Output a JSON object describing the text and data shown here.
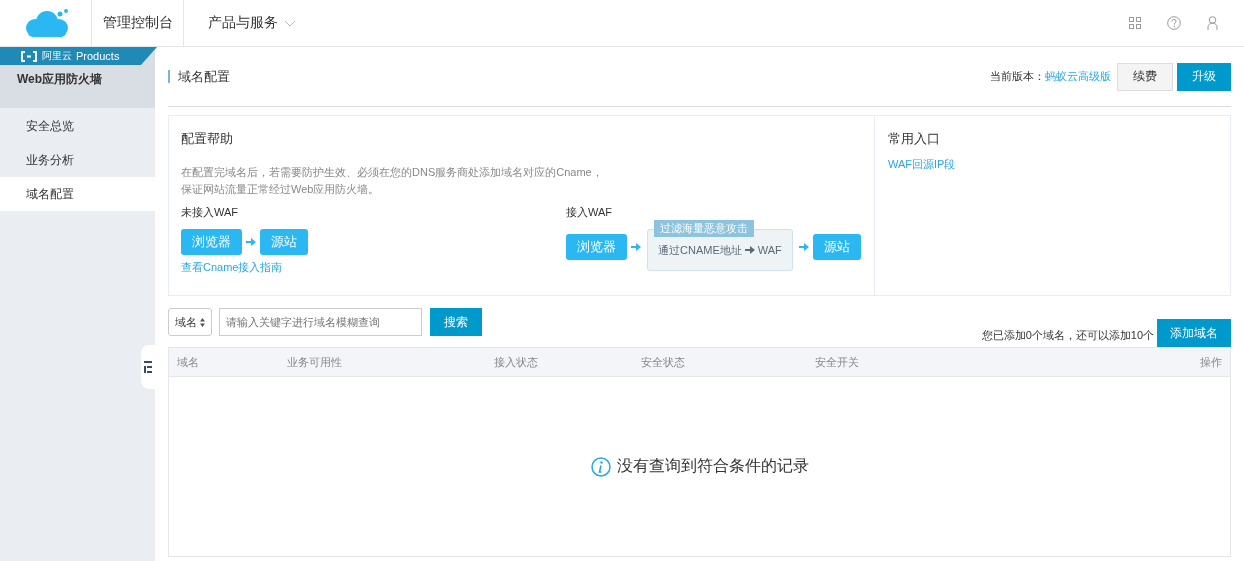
{
  "topbar": {
    "console": "管理控制台",
    "products_menu": "产品与服务"
  },
  "sidebar": {
    "brand": "阿里云",
    "brand_suffix": "Products",
    "product": "Web应用防火墙",
    "items": [
      {
        "label": "安全总览",
        "selected": false
      },
      {
        "label": "业务分析",
        "selected": false
      },
      {
        "label": "域名配置",
        "selected": true
      }
    ]
  },
  "header": {
    "title": "域名配置",
    "version_label": "当前版本：",
    "version": "蚂蚁云高级版",
    "buttons": [
      {
        "label": "续费",
        "kind": "default"
      },
      {
        "label": "升级",
        "kind": "primary"
      }
    ]
  },
  "help": {
    "title": "配置帮助",
    "description": [
      "在配置完域名后，若需要防护生效、必须在您的DNS服务商处添加域名对应的Cname，",
      "保证网站流量正常经过Web应用防火墙。"
    ],
    "without_waf": {
      "title": "未接入WAF",
      "nodes": [
        "浏览器",
        "源站"
      ],
      "link": "查看Cname接入指南"
    },
    "with_waf": {
      "title": "接入WAF",
      "source": "浏览器",
      "filter_tag": "过滤海量恶意攻击",
      "via": "通过CNAME地址",
      "via_target": "WAF",
      "target": "源站"
    }
  },
  "shortcuts": {
    "title": "常用入口",
    "links": [
      "WAF回源IP段"
    ]
  },
  "search": {
    "field_select": "域名",
    "placeholder": "请输入关键字进行域名模糊查询",
    "button": "搜索"
  },
  "quota": "您已添加0个域名，还可以添加10个",
  "add_button": "添加域名",
  "table": {
    "columns": [
      "域名",
      "业务可用性",
      "接入状态",
      "安全状态",
      "安全开关",
      "操作"
    ],
    "empty_message": "没有查询到符合条件的记录"
  }
}
